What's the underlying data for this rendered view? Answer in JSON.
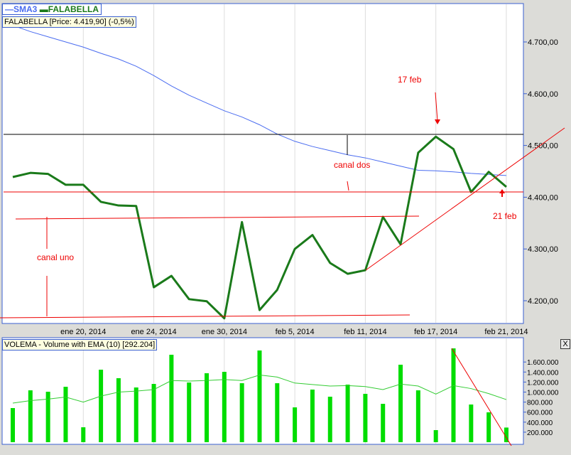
{
  "legend": {
    "sma_label": "SMA3",
    "price_label": "FALABELLA",
    "sma_color": "#4a6cf0",
    "price_color": "#1a7a1a"
  },
  "price_tooltip": "FALABELLA [Price: 4.419,90] (-0,5%)",
  "volume_tooltip": "VOLEMA - Volume with EMA (10) [292.204]",
  "close_label": "X",
  "annotations": {
    "canal_uno": "canal uno",
    "canal_dos": "canal dos",
    "feb17": "17 feb",
    "feb21": "21 feb"
  },
  "chart_data": [
    {
      "type": "line",
      "title": "FALABELLA",
      "ylim": [
        4150,
        4760
      ],
      "y_ticks": [
        "4.700,00",
        "4.600,00",
        "4.500,00",
        "4.400,00",
        "4.300,00",
        "4.200,00"
      ],
      "y_tick_values": [
        4700,
        4600,
        4500,
        4400,
        4300,
        4200
      ],
      "x_ticks": [
        {
          "index": 4,
          "label": "ene 20, 2014"
        },
        {
          "index": 8,
          "label": "ene 24, 2014"
        },
        {
          "index": 12,
          "label": "ene 30, 2014"
        },
        {
          "index": 16,
          "label": "feb 5, 2014"
        },
        {
          "index": 20,
          "label": "feb 11, 2014"
        },
        {
          "index": 24,
          "label": "feb 17, 2014"
        },
        {
          "index": 28,
          "label": "feb 21, 2014"
        }
      ],
      "series": [
        {
          "name": "FALABELLA",
          "values": [
            4439,
            4447,
            4445,
            4424,
            4424,
            4391,
            4384,
            4383,
            4226,
            4248,
            4203,
            4199,
            4166,
            4352,
            4182,
            4221,
            4300,
            4327,
            4273,
            4252,
            4259,
            4362,
            4309,
            4486,
            4517,
            4493,
            4410,
            4449,
            4420
          ]
        },
        {
          "name": "SMA3",
          "values": [
            4732,
            4720,
            4710,
            4700,
            4690,
            4678,
            4667,
            4653,
            4635,
            4615,
            4597,
            4582,
            4567,
            4555,
            4540,
            4522,
            4508,
            4498,
            4490,
            4482,
            4476,
            4468,
            4460,
            4452,
            4451,
            4449,
            4446,
            4444,
            4442
          ]
        }
      ]
    },
    {
      "type": "bar",
      "title": "VOLEMA - Volume with EMA (10)",
      "ylim": [
        0,
        1900000
      ],
      "y_ticks": [
        "1.600.000",
        "1.400.000",
        "1.200.000",
        "1.000.000",
        "800.000",
        "600.000",
        "400.000",
        "200.000"
      ],
      "y_tick_values": [
        1600000,
        1400000,
        1200000,
        1000000,
        800000,
        600000,
        400000,
        200000
      ],
      "series": [
        {
          "name": "Volume",
          "values": [
            681000,
            1035000,
            1007000,
            1106000,
            298000,
            1447000,
            1277000,
            1092000,
            1163000,
            1745000,
            1191000,
            1376000,
            1404000,
            1177000,
            1830000,
            1177000,
            695000,
            1050000,
            908000,
            1149000,
            965000,
            766000,
            1546000,
            1035000,
            241000,
            1872000,
            752000,
            596000,
            292204
          ]
        },
        {
          "name": "EMA (10)",
          "values": [
            780000,
            830000,
            860000,
            900000,
            800000,
            920000,
            1000000,
            1020000,
            1050000,
            1230000,
            1220000,
            1230000,
            1250000,
            1230000,
            1340000,
            1300000,
            1180000,
            1150000,
            1120000,
            1130000,
            1110000,
            1050000,
            1160000,
            1120000,
            960000,
            1130000,
            1070000,
            970000,
            850000
          ]
        }
      ]
    }
  ]
}
